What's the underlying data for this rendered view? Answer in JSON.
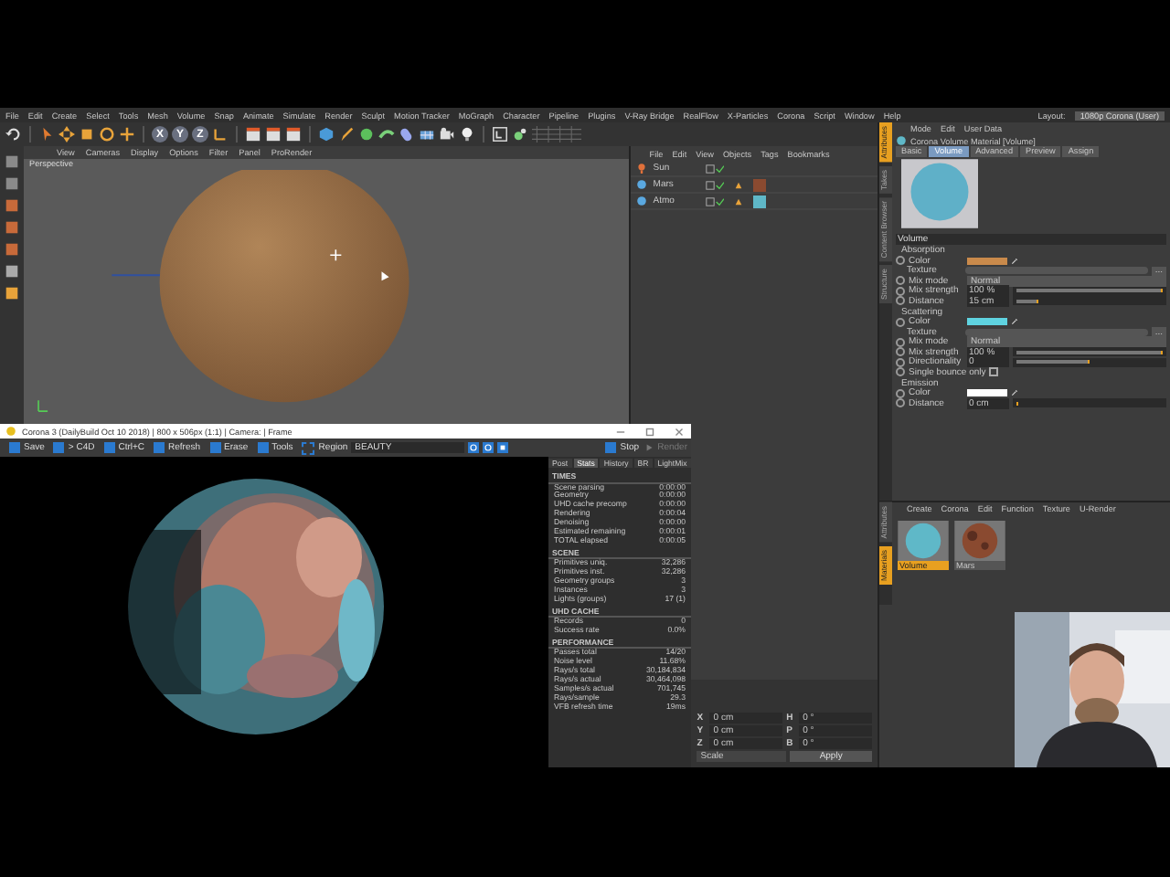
{
  "menu": [
    "File",
    "Edit",
    "Create",
    "Select",
    "Tools",
    "Mesh",
    "Volume",
    "Snap",
    "Animate",
    "Simulate",
    "Render",
    "Sculpt",
    "Motion Tracker",
    "MoGraph",
    "Character",
    "Pipeline",
    "Plugins",
    "V-Ray Bridge",
    "RealFlow",
    "X-Particles",
    "Corona",
    "Script",
    "Window",
    "Help"
  ],
  "layout": {
    "label": "Layout:",
    "value": "1080p Corona (User)"
  },
  "toolbar_axes": [
    "X",
    "Y",
    "Z"
  ],
  "viewport": {
    "menu": [
      "View",
      "Cameras",
      "Display",
      "Options",
      "Filter",
      "Panel",
      "ProRender"
    ],
    "label": "Perspective"
  },
  "object_manager": {
    "menu": [
      "File",
      "Edit",
      "View",
      "Objects",
      "Tags",
      "Bookmarks"
    ],
    "objects": [
      {
        "name": "Sun",
        "kind": "light"
      },
      {
        "name": "Mars",
        "kind": "sphere",
        "material_tag": {
          "color": "#8a4a30"
        }
      },
      {
        "name": "Atmo",
        "kind": "sphere",
        "material_tag": {
          "color": "#5fb8c8"
        }
      }
    ]
  },
  "attributes": {
    "side_tabs": [
      {
        "label": "Attributes",
        "selected": true
      },
      {
        "label": "Takes",
        "selected": false
      },
      {
        "label": "Content Browser",
        "selected": false
      },
      {
        "label": "Structure",
        "selected": false
      }
    ],
    "menu": [
      "Mode",
      "Edit",
      "User Data"
    ],
    "title": "Corona Volume Material [Volume]",
    "tabs": [
      {
        "label": "Basic",
        "selected": false
      },
      {
        "label": "Volume",
        "selected": true
      },
      {
        "label": "Advanced",
        "selected": false
      },
      {
        "label": "Preview",
        "selected": false
      },
      {
        "label": "Assign",
        "selected": false
      }
    ],
    "section": "Volume",
    "groups": [
      {
        "title": "Absorption",
        "rows": [
          {
            "kind": "color",
            "label": "Color",
            "color": "#c98a4b"
          },
          {
            "kind": "texture",
            "label": "Texture",
            "button": "..."
          },
          {
            "kind": "dropdown",
            "label": "Mix mode",
            "value": "Normal"
          },
          {
            "kind": "slider",
            "label": "Mix strength",
            "value": "100 %",
            "level": 1
          },
          {
            "kind": "slider",
            "label": "Distance",
            "value": "15 cm",
            "level": 0.15
          }
        ]
      },
      {
        "title": "Scattering",
        "rows": [
          {
            "kind": "color",
            "label": "Color",
            "color": "#5fd3e0"
          },
          {
            "kind": "texture",
            "label": "Texture",
            "button": "..."
          },
          {
            "kind": "dropdown",
            "label": "Mix mode",
            "value": "Normal"
          },
          {
            "kind": "slider",
            "label": "Mix strength",
            "value": "100 %",
            "level": 1
          },
          {
            "kind": "slider",
            "label": "Directionality",
            "value": "0",
            "level": 0.5
          },
          {
            "kind": "checkbox",
            "label": "Single bounce only",
            "checked": false
          }
        ]
      },
      {
        "title": "Emission",
        "rows": [
          {
            "kind": "color",
            "label": "Color",
            "color": "#ffffff"
          },
          {
            "kind": "slider",
            "label": "Distance",
            "value": "0 cm",
            "level": 0
          }
        ]
      }
    ]
  },
  "materials": {
    "side_tabs": [
      {
        "label": "Attributes",
        "selected": false
      },
      {
        "label": "Materials",
        "selected": true
      }
    ],
    "menu": [
      "Create",
      "Corona",
      "Edit",
      "Function",
      "Texture",
      "U-Render"
    ],
    "items": [
      {
        "name": "Volume",
        "kind": "cyan",
        "selected": true
      },
      {
        "name": "Mars",
        "kind": "rock",
        "selected": false
      }
    ]
  },
  "vfb": {
    "title": "Corona 3 (DailyBuild Oct 10 2018) | 800 x 506px (1:1) | Camera: | Frame",
    "toolbar": [
      "Save",
      "> C4D",
      "Ctrl+C",
      "Refresh",
      "Erase",
      "Tools"
    ],
    "region": "Region",
    "channel": "BEAUTY",
    "stop": "Stop",
    "render": "Render",
    "tabs": [
      {
        "label": "Post",
        "selected": false
      },
      {
        "label": "Stats",
        "selected": true
      },
      {
        "label": "History",
        "selected": false
      },
      {
        "label": "BR",
        "selected": false
      },
      {
        "label": "LightMix",
        "selected": false
      }
    ],
    "sections": [
      {
        "title": "TIMES",
        "rows": [
          [
            "Scene parsing",
            "0:00:00"
          ],
          [
            "Geometry",
            "0:00:00"
          ],
          [
            "UHD cache precomp",
            "0:00:00"
          ],
          [
            "Rendering",
            "0:00:04"
          ],
          [
            "Denoising",
            "0:00:00"
          ],
          [
            "Estimated remaining",
            "0:00:01"
          ],
          [
            "TOTAL elapsed",
            "0:00:05"
          ]
        ]
      },
      {
        "title": "SCENE",
        "rows": [
          [
            "Primitives uniq.",
            "32,286"
          ],
          [
            "Primitives inst.",
            "32,286"
          ],
          [
            "Geometry groups",
            "3"
          ],
          [
            "Instances",
            "3"
          ],
          [
            "Lights (groups)",
            "17 (1)"
          ]
        ]
      },
      {
        "title": "UHD CACHE",
        "rows": [
          [
            "Records",
            "0"
          ],
          [
            "Success rate",
            "0.0%"
          ]
        ]
      },
      {
        "title": "PERFORMANCE",
        "rows": [
          [
            "Passes total",
            "14/20"
          ],
          [
            "Noise level",
            "11.68%"
          ],
          [
            "Rays/s total",
            "30,184,834"
          ],
          [
            "Rays/s actual",
            "30,464,098"
          ],
          [
            "Samples/s actual",
            "701,745"
          ],
          [
            "Rays/sample",
            "29.3"
          ],
          [
            "VFB refresh time",
            "19ms"
          ]
        ]
      }
    ]
  },
  "coordinates": {
    "rows": [
      {
        "axis": "X",
        "value": "0 cm",
        "rot_axis": "H",
        "rot_value": "0 °"
      },
      {
        "axis": "Y",
        "value": "0 cm",
        "rot_axis": "P",
        "rot_value": "0 °"
      },
      {
        "axis": "Z",
        "value": "0 cm",
        "rot_axis": "B",
        "rot_value": "0 °"
      }
    ],
    "mode": "Scale",
    "apply": "Apply"
  },
  "webcam": {
    "kind": "picture"
  }
}
